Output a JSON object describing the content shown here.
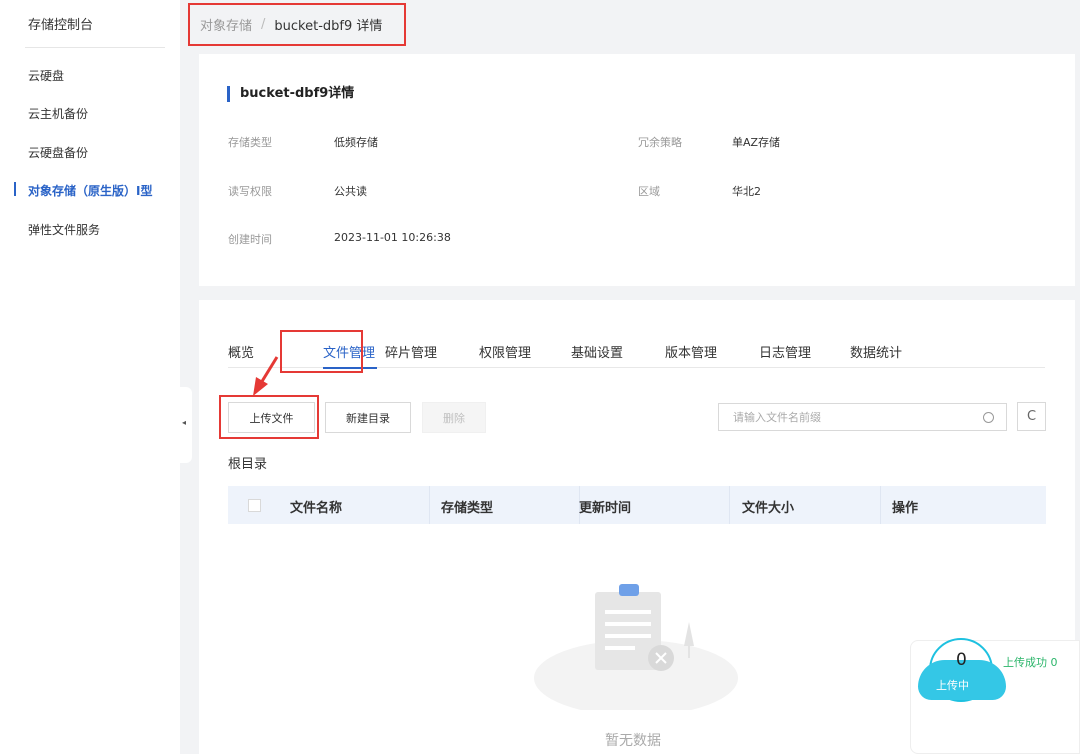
{
  "sidebar": {
    "title": "存储控制台",
    "items": [
      {
        "label": "云硬盘",
        "active": false
      },
      {
        "label": "云主机备份",
        "active": false
      },
      {
        "label": "云硬盘备份",
        "active": false
      },
      {
        "label": "对象存储（原生版）Ⅰ型",
        "active": true
      },
      {
        "label": "弹性文件服务",
        "active": false
      }
    ],
    "collapse_glyph": "◂"
  },
  "breadcrumb": {
    "parent": "对象存储",
    "separator": "/",
    "current": "bucket-dbf9 详情"
  },
  "info": {
    "title": "bucket-dbf9详情",
    "fields": {
      "storage_type": {
        "label": "存储类型",
        "value": "低频存储"
      },
      "redundancy": {
        "label": "冗余策略",
        "value": "单AZ存储"
      },
      "permission": {
        "label": "读写权限",
        "value": "公共读"
      },
      "region": {
        "label": "区域",
        "value": "华北2"
      },
      "created": {
        "label": "创建时间",
        "value": "2023-11-01 10:26:38"
      }
    }
  },
  "tabs": [
    "概览",
    "文件管理",
    "碎片管理",
    "权限管理",
    "基础设置",
    "版本管理",
    "日志管理",
    "数据统计"
  ],
  "active_tab": "文件管理",
  "toolbar": {
    "upload_label": "上传文件",
    "new_dir_label": "新建目录",
    "delete_label": "删除",
    "search_placeholder": "请输入文件名前缀",
    "refresh_glyph": "C"
  },
  "root_label": "根目录",
  "table": {
    "columns": [
      "文件名称",
      "存储类型",
      "更新时间",
      "文件大小",
      "操作"
    ]
  },
  "empty_text": "暂无数据",
  "upload_widget": {
    "count": "0",
    "uploading_label": "上传中",
    "success_text": "上传成功 0"
  },
  "colors": {
    "accent": "#2a63c7",
    "annotation_red": "#e53935",
    "success_green": "#2bb56a",
    "upload_cyan": "#34c7e6"
  }
}
